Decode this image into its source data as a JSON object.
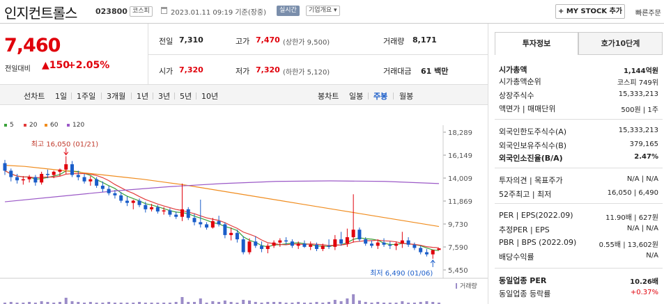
{
  "header": {
    "stock_name": "인지컨트롤스",
    "stock_code": "023800",
    "market": "코스피",
    "datetime": "2023.01.11 09:19  기준(장중)",
    "realtime": "실시간",
    "company_overview": "기업개요 ▾",
    "mystock_button": "+ MY STOCK 추가",
    "quick_order": "빠른주문"
  },
  "price": {
    "current": "7,460",
    "change_label": "전일대비",
    "change_value": "▲150",
    "change_pct": "+2.05%"
  },
  "quote": {
    "prev_close_label": "전일",
    "prev_close": "7,310",
    "high_label": "고가",
    "high": "7,470",
    "upper_limit": "(상한가 9,500)",
    "volume_label": "거래량",
    "volume": "8,171",
    "open_label": "시가",
    "open": "7,320",
    "low_label": "저가",
    "low": "7,320",
    "lower_limit": "(하한가 5,120)",
    "amount_label": "거래대금",
    "amount": "61 백만"
  },
  "period_bar": {
    "line_label": "선차트",
    "line_periods": [
      "1일",
      "1주일",
      "3개월",
      "1년",
      "3년",
      "5년",
      "10년"
    ],
    "candle_label": "봉차트",
    "candle_periods": [
      "일봉",
      "주봉",
      "월봉"
    ],
    "active_candle": "주봉"
  },
  "chart_data": {
    "type": "candlestick",
    "legend": [
      {
        "name": "5",
        "color": "#3aa23a"
      },
      {
        "name": "20",
        "color": "#e23b3b"
      },
      {
        "name": "60",
        "color": "#f08c1e"
      },
      {
        "name": "120",
        "color": "#9b59c7"
      }
    ],
    "y_ticks": [
      "18,289",
      "16,149",
      "14,009",
      "11,869",
      "9,730",
      "7,590",
      "5,450"
    ],
    "ylim": [
      5450,
      18289
    ],
    "high_annotation": "최고 16,050 (01/21)",
    "low_annotation": "최저 6,490 (01/06)",
    "volume_label": "거래량",
    "candles": [
      [
        15400,
        15700,
        14300,
        14700
      ],
      [
        14700,
        14900,
        13700,
        14100
      ],
      [
        14100,
        14400,
        13500,
        13800
      ],
      [
        13800,
        14200,
        13400,
        13900
      ],
      [
        13900,
        14300,
        13600,
        14100
      ],
      [
        14100,
        14300,
        13300,
        13600
      ],
      [
        13600,
        14600,
        13400,
        14400
      ],
      [
        14400,
        14800,
        14000,
        14300
      ],
      [
        14300,
        14700,
        14000,
        14600
      ],
      [
        14600,
        14900,
        14200,
        14800
      ],
      [
        14800,
        16050,
        14400,
        15300
      ],
      [
        15300,
        15600,
        14100,
        14300
      ],
      [
        14300,
        14700,
        13800,
        14100
      ],
      [
        14100,
        14400,
        13500,
        13700
      ],
      [
        13700,
        14200,
        13300,
        13900
      ],
      [
        13900,
        14100,
        13100,
        13300
      ],
      [
        13300,
        13700,
        12700,
        13000
      ],
      [
        13000,
        13300,
        12400,
        12600
      ],
      [
        12600,
        12900,
        12100,
        12400
      ],
      [
        12400,
        12700,
        11700,
        11900
      ],
      [
        11900,
        12300,
        11400,
        11700
      ],
      [
        11700,
        12000,
        11100,
        11900
      ],
      [
        11900,
        12100,
        11300,
        11500
      ],
      [
        11500,
        11800,
        10800,
        11100
      ],
      [
        11100,
        11600,
        10900,
        11300
      ],
      [
        11300,
        11500,
        10700,
        10900
      ],
      [
        10900,
        11300,
        10600,
        11000
      ],
      [
        11000,
        11200,
        10400,
        10600
      ],
      [
        10600,
        10900,
        10200,
        10400
      ],
      [
        10400,
        13500,
        10000,
        11100
      ],
      [
        11100,
        11300,
        10100,
        10300
      ],
      [
        10300,
        10700,
        9600,
        9900
      ],
      [
        9900,
        12000,
        9400,
        9700
      ],
      [
        9700,
        9900,
        9200,
        9400
      ],
      [
        9400,
        10300,
        9300,
        10000
      ],
      [
        10000,
        10500,
        9500,
        9700
      ],
      [
        9700,
        9900,
        8400,
        8700
      ],
      [
        8700,
        9400,
        8200,
        8900
      ],
      [
        8900,
        9200,
        8000,
        8300
      ],
      [
        8300,
        8600,
        6900,
        7100
      ],
      [
        7100,
        8400,
        6900,
        8100
      ],
      [
        8100,
        8600,
        7500,
        7700
      ],
      [
        7700,
        8100,
        7100,
        7400
      ],
      [
        7400,
        7900,
        7000,
        7700
      ],
      [
        7700,
        8200,
        7500,
        8000
      ],
      [
        8000,
        8400,
        7600,
        8200
      ],
      [
        8200,
        8500,
        7800,
        8100
      ],
      [
        8100,
        8300,
        7500,
        7700
      ],
      [
        7700,
        8100,
        7400,
        7900
      ],
      [
        7900,
        8200,
        7500,
        7600
      ],
      [
        7600,
        8100,
        7300,
        7800
      ],
      [
        7800,
        8000,
        7200,
        7400
      ],
      [
        7400,
        7900,
        7200,
        7700
      ],
      [
        7700,
        8300,
        7400,
        7600
      ],
      [
        7600,
        8700,
        7300,
        8300
      ],
      [
        8300,
        9000,
        7700,
        7900
      ],
      [
        7900,
        9300,
        7600,
        8500
      ],
      [
        8500,
        12500,
        8000,
        9200
      ],
      [
        9200,
        9400,
        8100,
        8300
      ],
      [
        8300,
        8500,
        7700,
        7900
      ],
      [
        7900,
        8200,
        7500,
        7700
      ],
      [
        7700,
        8300,
        7400,
        8000
      ],
      [
        8000,
        8400,
        7600,
        7800
      ],
      [
        7800,
        8100,
        7400,
        7700
      ],
      [
        7700,
        8100,
        7300,
        7900
      ],
      [
        7900,
        9000,
        7500,
        8200
      ],
      [
        8200,
        8500,
        7600,
        7800
      ],
      [
        7800,
        8000,
        7300,
        7500
      ],
      [
        7500,
        7700,
        6900,
        7100
      ],
      [
        7100,
        7400,
        6700,
        6900
      ],
      [
        6900,
        7300,
        6490,
        7300
      ],
      [
        7310,
        7470,
        7320,
        7460
      ]
    ]
  },
  "invest": {
    "tab_invest": "투자정보",
    "tab_hoga": "호가10단계",
    "rows": [
      {
        "label": "시가총액",
        "value": "1,144억원",
        "bold": true
      },
      {
        "label": "시가총액순위",
        "value": "코스피 749위"
      },
      {
        "label": "상장주식수",
        "value": "15,333,213"
      },
      {
        "label": "액면가 | 매매단위",
        "value": "500원 | 1주"
      },
      {
        "label": "외국인한도주식수(A)",
        "value": "15,333,213"
      },
      {
        "label": "외국인보유주식수(B)",
        "value": "379,165"
      },
      {
        "label": "외국인소진율(B/A)",
        "value": "2.47%",
        "bold": true
      },
      {
        "label": "투자의견 | 목표주가",
        "value": "N/A | N/A"
      },
      {
        "label": "52주최고 | 최저",
        "value": "16,050 | 6,490"
      },
      {
        "label": "PER | EPS(2022.09)",
        "value": "11.90배 | 627원"
      },
      {
        "label": "추정PER | EPS",
        "value": "N/A | N/A"
      },
      {
        "label": "PBR | BPS (2022.09)",
        "value": "0.55배 | 13,602원"
      },
      {
        "label": "배당수익률",
        "value": "N/A"
      },
      {
        "label": "동일업종 PER",
        "value": "10.26배",
        "bold": true
      },
      {
        "label": "동일업종 등락률",
        "value": "+0.37%"
      }
    ]
  }
}
